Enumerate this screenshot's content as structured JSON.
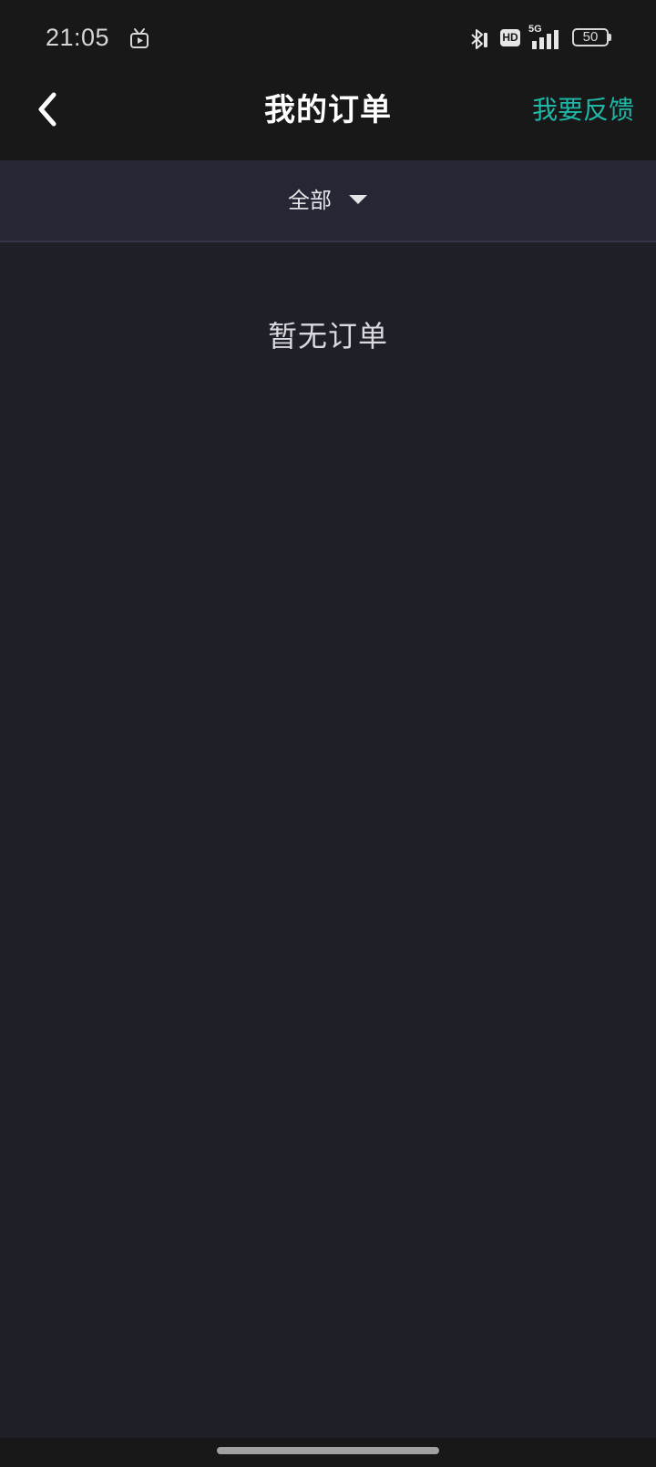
{
  "status_bar": {
    "time": "21:05",
    "network_label": "5G",
    "hd_label": "HD",
    "battery": "50",
    "icons": [
      "tv-icon",
      "bluetooth-icon",
      "hd-icon",
      "signal-icon",
      "battery-icon"
    ]
  },
  "header": {
    "back_icon": "chevron-left-icon",
    "title": "我的订单",
    "feedback_label": "我要反馈"
  },
  "filter": {
    "selected": "全部",
    "icon": "caret-down-icon"
  },
  "main": {
    "empty_text": "暂无订单"
  },
  "colors": {
    "background": "#1f1f27",
    "bar": "#181818",
    "filter_bar": "#252735",
    "accent": "#1fb7a8",
    "text": "#ffffff"
  }
}
